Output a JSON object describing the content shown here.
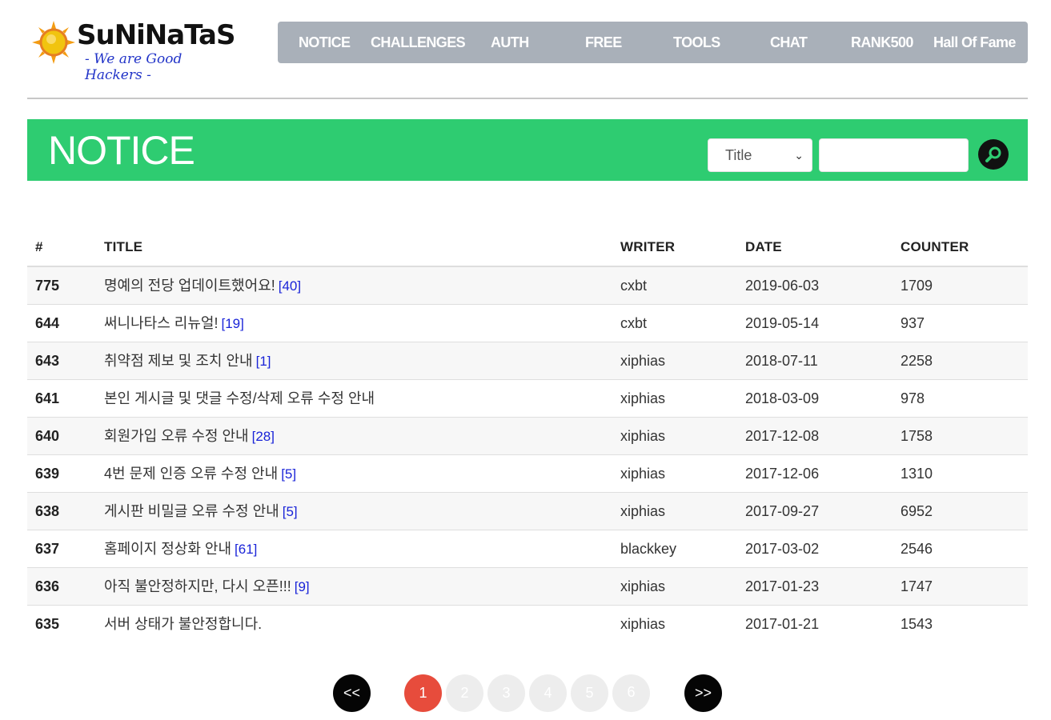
{
  "brand": {
    "name": "SuNiNaTaS",
    "tagline": "- We are Good Hackers -"
  },
  "nav": [
    {
      "label": "NOTICE"
    },
    {
      "label": "CHALLENGES"
    },
    {
      "label": "AUTH"
    },
    {
      "label": "FREE"
    },
    {
      "label": "TOOLS"
    },
    {
      "label": "CHAT"
    },
    {
      "label": "RANK500"
    },
    {
      "label": "Hall Of Fame"
    }
  ],
  "banner": {
    "title": "NOTICE",
    "search_field": "Title",
    "search_value": ""
  },
  "table": {
    "headers": {
      "num": "#",
      "title": "TITLE",
      "writer": "WRITER",
      "date": "DATE",
      "counter": "COUNTER"
    },
    "rows": [
      {
        "num": "775",
        "title": "명예의 전당 업데이트했어요!",
        "comments": "[40]",
        "writer": "cxbt",
        "date": "2019-06-03",
        "counter": "1709"
      },
      {
        "num": "644",
        "title": "써니나타스 리뉴얼!",
        "comments": "[19]",
        "writer": "cxbt",
        "date": "2019-05-14",
        "counter": "937"
      },
      {
        "num": "643",
        "title": "취약점 제보 및 조치 안내",
        "comments": "[1]",
        "writer": "xiphias",
        "date": "2018-07-11",
        "counter": "2258"
      },
      {
        "num": "641",
        "title": "본인 게시글 및 댓글 수정/삭제 오류 수정 안내",
        "comments": "",
        "writer": "xiphias",
        "date": "2018-03-09",
        "counter": "978"
      },
      {
        "num": "640",
        "title": "회원가입 오류 수정 안내",
        "comments": "[28]",
        "writer": "xiphias",
        "date": "2017-12-08",
        "counter": "1758"
      },
      {
        "num": "639",
        "title": "4번 문제 인증 오류 수정 안내",
        "comments": "[5]",
        "writer": "xiphias",
        "date": "2017-12-06",
        "counter": "1310"
      },
      {
        "num": "638",
        "title": "게시판 비밀글 오류 수정 안내",
        "comments": "[5]",
        "writer": "xiphias",
        "date": "2017-09-27",
        "counter": "6952"
      },
      {
        "num": "637",
        "title": "홈페이지 정상화 안내",
        "comments": "[61]",
        "writer": "blackkey",
        "date": "2017-03-02",
        "counter": "2546"
      },
      {
        "num": "636",
        "title": "아직 불안정하지만, 다시 오픈!!!",
        "comments": "[9]",
        "writer": "xiphias",
        "date": "2017-01-23",
        "counter": "1747"
      },
      {
        "num": "635",
        "title": "서버 상태가 불안정합니다.",
        "comments": "",
        "writer": "xiphias",
        "date": "2017-01-21",
        "counter": "1543"
      }
    ]
  },
  "pager": {
    "prev": "<<",
    "next": ">>",
    "pages": [
      "1",
      "2",
      "3",
      "4",
      "5",
      "6"
    ],
    "current": "1"
  },
  "colors": {
    "banner_green": "#2ecc71",
    "nav_gray": "#a9b0b9",
    "active_page": "#e74c3c",
    "comment_count": "#1a24d8"
  }
}
